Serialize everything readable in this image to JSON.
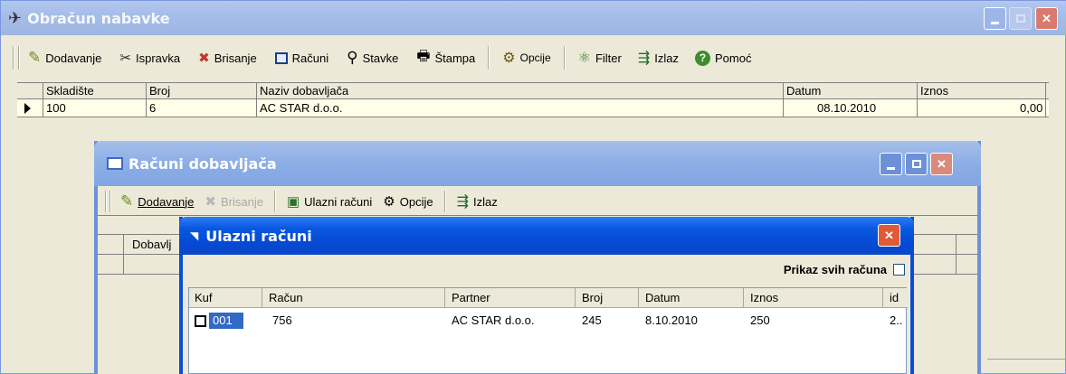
{
  "main": {
    "title": "Obračun nabavke",
    "toolbar": {
      "add": "Dodavanje",
      "edit": "Ispravka",
      "delete": "Brisanje",
      "invoices": "Računi",
      "items": "Stavke",
      "print": "Štampa",
      "options": "Opcije",
      "filter": "Filter",
      "exit": "Izlaz",
      "help": "Pomoć"
    },
    "columns": [
      "Skladište",
      "Broj",
      "Naziv dobavljača",
      "Datum",
      "Iznos"
    ],
    "row": {
      "skladiste": "100",
      "broj": "6",
      "naziv": "AC STAR d.o.o.",
      "datum": "08.10.2010",
      "iznos": "0,00"
    }
  },
  "supplier_window": {
    "title": "Računi dobavljača",
    "toolbar": {
      "add": "Dodavanje",
      "delete": "Brisanje",
      "incoming": "Ulazni računi",
      "options": "Opcije",
      "exit": "Izlaz"
    },
    "col_partial": "Dobavlj"
  },
  "incoming_dialog": {
    "title": "Ulazni računi",
    "show_all_label": "Prikaz svih računa",
    "columns": [
      "Kuf",
      "Račun",
      "Partner",
      "Broj",
      "Datum",
      "Iznos",
      "id"
    ],
    "row": {
      "kuf": "001",
      "racun": "756",
      "partner": "AC STAR d.o.o.",
      "broj": "245",
      "datum": "8.10.2010",
      "iznos": "250",
      "id": "2.."
    }
  }
}
